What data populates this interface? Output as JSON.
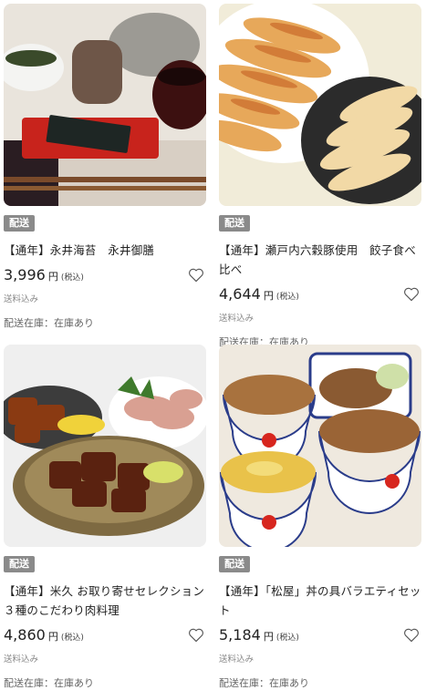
{
  "products": [
    {
      "tag": "配送",
      "title": "【通年】永井海苔　永井御膳",
      "price": "3,996",
      "price_unit": "円",
      "tax": "(税込)",
      "shipping": "送料込み",
      "stock": "配送在庫：在庫あり",
      "image_icon": "nori-meal-image"
    },
    {
      "tag": "配送",
      "title": "【通年】瀬戸内六穀豚使用　餃子食べ比べ",
      "price": "4,644",
      "price_unit": "円",
      "tax": "(税込)",
      "shipping": "送料込み",
      "stock": "配送在庫：在庫あり",
      "image_icon": "gyoza-image"
    },
    {
      "tag": "配送",
      "title": "【通年】米久 お取り寄せセレクション ３種のこだわり肉料理",
      "price": "4,860",
      "price_unit": "円",
      "tax": "(税込)",
      "shipping": "送料込み",
      "stock": "配送在庫：在庫あり",
      "image_icon": "meat-dishes-image"
    },
    {
      "tag": "配送",
      "title": "【通年】「松屋」丼の具バラエティセット",
      "price": "5,184",
      "price_unit": "円",
      "tax": "(税込)",
      "shipping": "送料込み",
      "stock": "配送在庫：在庫あり",
      "image_icon": "donburi-image"
    }
  ],
  "colors": {
    "tag_bg": "#8a8a8a",
    "text": "#222222",
    "muted": "#888888"
  }
}
